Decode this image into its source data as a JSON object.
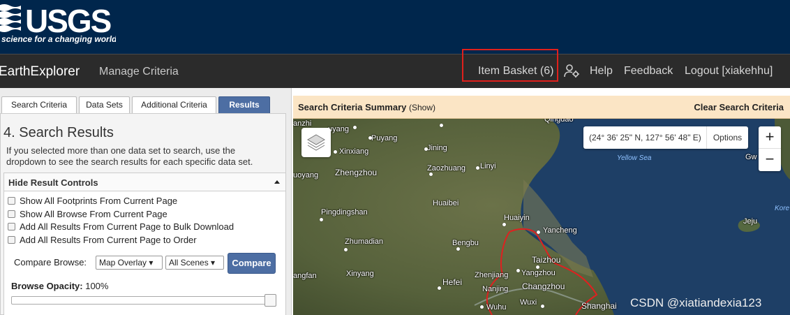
{
  "logo": {
    "name": "USGS",
    "tagline": "science for a changing world"
  },
  "nav": {
    "brand": "EarthExplorer",
    "manage": "Manage Criteria",
    "basket": "Item Basket (6)",
    "help": "Help",
    "feedback": "Feedback",
    "logout": "Logout [xiakehhu]"
  },
  "tabs": [
    {
      "label": "Search Criteria"
    },
    {
      "label": "Data Sets"
    },
    {
      "label": "Additional Criteria"
    },
    {
      "label": "Results",
      "active": true
    }
  ],
  "results": {
    "title": "4. Search Results",
    "description": "If you selected more than one data set to search, use the dropdown to see the search results for each specific data set.",
    "controls_header": "Hide Result Controls",
    "checkboxes": [
      {
        "label": "Show All Footprints From Current Page",
        "checked": false
      },
      {
        "label": "Show All Browse From Current Page",
        "checked": false
      },
      {
        "label": "Add All Results From Current Page to Bulk Download",
        "checked": false
      },
      {
        "label": "Add All Results From Current Page to Order",
        "checked": false
      }
    ],
    "compare_label": "Compare Browse:",
    "compare_select1": "Map Overlay",
    "compare_select2": "All Scenes",
    "compare_button": "Compare",
    "opacity_label": "Browse Opacity:",
    "opacity_value": "100%",
    "opacity_fraction": 1.0
  },
  "map": {
    "summary_title": "Search Criteria Summary",
    "summary_show": "(Show)",
    "clear": "Clear Search Criteria",
    "coordinates": "(24° 36' 25\" N, 127° 56' 48\" E)",
    "options": "Options",
    "zoom_in": "+",
    "zoom_out": "−",
    "labels": {
      "qingdao": "Qingdao",
      "puyang": "Puyang",
      "uyang": "uyang",
      "anzhi": "anzhi",
      "xinxiang": "Xinxiang",
      "jining": "Jining",
      "zhengzhou": "Zhengzhou",
      "zaozhuang": "Zaozhuang",
      "linyi": "Linyi",
      "luoyang": "uoyang",
      "huaibei": "Huaibei",
      "pingdingshan": "Pingdingshan",
      "huaiyin": "Huaiyin",
      "yancheng": "Yancheng",
      "zhumadian": "Zhumadian",
      "bengbu": "Bengbu",
      "taizhou": "Taizhou",
      "xinyang": "Xinyang",
      "zhenjiang": "Zhenjiang",
      "yangzhou": "Yangzhou",
      "hefei": "Hefei",
      "nanjing": "Nanjing",
      "changzhou": "Changzhou",
      "angfan": "angfan",
      "wuxi": "Wuxi",
      "wuhu": "Wuhu",
      "shanghai": "Shanghai",
      "jeju": "Jeju",
      "gw": "Gw",
      "kore": "Kore",
      "yellow_sea": "Yellow Sea"
    }
  },
  "watermark": "CSDN @xiatiandexia123",
  "colors": {
    "banner": "#00264c",
    "navbar": "#2b2b2b",
    "tab_active": "#4d6ea3",
    "summary_bar": "#fbe5c5",
    "highlight": "#e0201c"
  }
}
